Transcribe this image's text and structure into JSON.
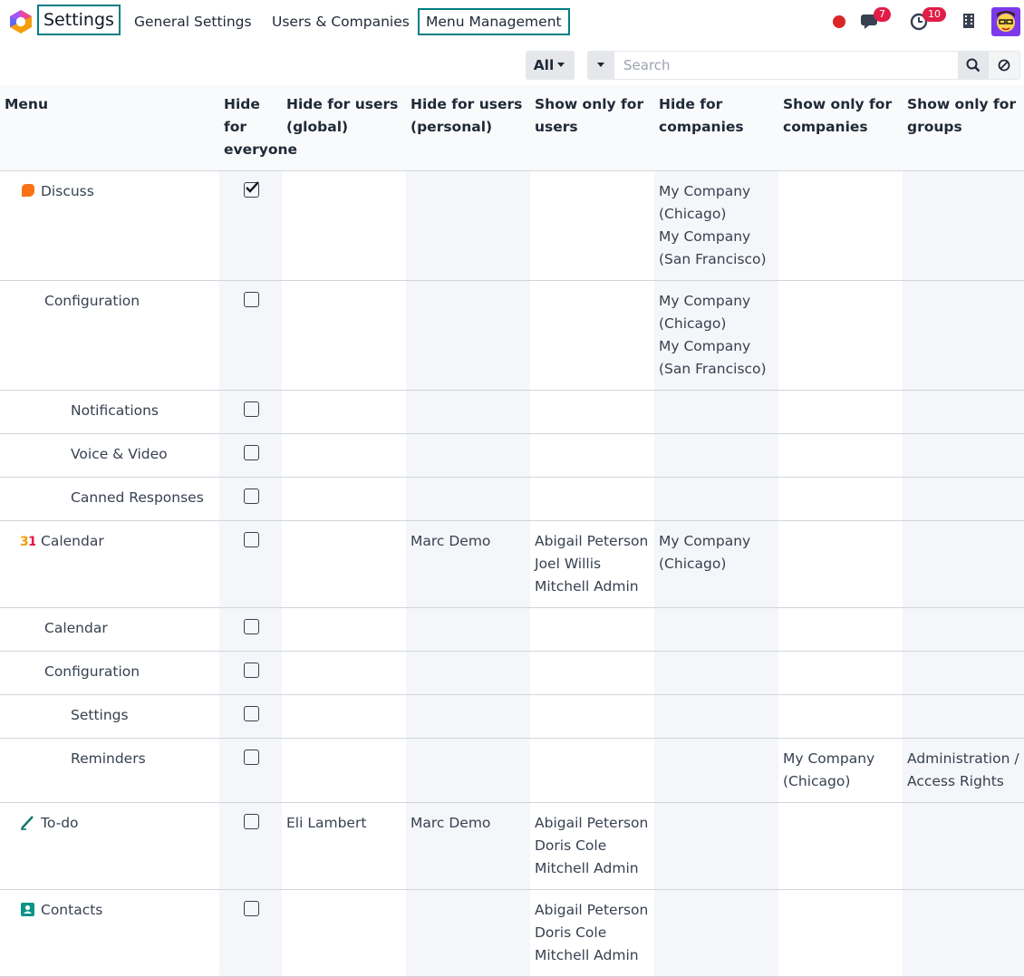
{
  "app": {
    "title": "Settings",
    "nav": [
      "General Settings",
      "Users & Companies",
      "Menu Management"
    ],
    "messages_count": "7",
    "activity_count": "10",
    "accent": "#017e84"
  },
  "controls": {
    "filter_label": "All",
    "search_placeholder": "Search"
  },
  "columns": [
    "Menu",
    "Hide for everyone",
    "Hide for users (global)",
    "Hide for users (personal)",
    "Show only for users",
    "Hide for companies",
    "Show only for companies",
    "Show only for groups"
  ],
  "rows": [
    {
      "name": "Discuss",
      "level": 0,
      "icon": "discuss-icon",
      "checked": true,
      "global": [],
      "personal": [],
      "show_users": [],
      "hide_companies": [
        "My Company",
        "(Chicago)",
        "My Company",
        "(San Francisco)"
      ],
      "show_companies": [],
      "groups": []
    },
    {
      "name": "Configuration",
      "level": 1,
      "checked": false,
      "global": [],
      "personal": [],
      "show_users": [],
      "hide_companies": [
        "My Company",
        "(Chicago)",
        "My Company",
        "(San Francisco)"
      ],
      "show_companies": [],
      "groups": []
    },
    {
      "name": "Notifications",
      "level": 2,
      "checked": false,
      "global": [],
      "personal": [],
      "show_users": [],
      "hide_companies": [],
      "show_companies": [],
      "groups": []
    },
    {
      "name": "Voice & Video",
      "level": 2,
      "checked": false,
      "global": [],
      "personal": [],
      "show_users": [],
      "hide_companies": [],
      "show_companies": [],
      "groups": []
    },
    {
      "name": "Canned Responses",
      "level": 2,
      "checked": false,
      "global": [],
      "personal": [],
      "show_users": [],
      "hide_companies": [],
      "show_companies": [],
      "groups": []
    },
    {
      "name": "Calendar",
      "level": 0,
      "icon": "calendar-icon",
      "checked": false,
      "global": [],
      "personal": [
        "Marc Demo"
      ],
      "show_users": [
        "Abigail Peterson",
        "Joel Willis",
        "Mitchell Admin"
      ],
      "hide_companies": [
        "My Company",
        "(Chicago)"
      ],
      "show_companies": [],
      "groups": []
    },
    {
      "name": "Calendar",
      "level": 1,
      "checked": false,
      "global": [],
      "personal": [],
      "show_users": [],
      "hide_companies": [],
      "show_companies": [],
      "groups": []
    },
    {
      "name": "Configuration",
      "level": 1,
      "checked": false,
      "global": [],
      "personal": [],
      "show_users": [],
      "hide_companies": [],
      "show_companies": [],
      "groups": []
    },
    {
      "name": "Settings",
      "level": 2,
      "checked": false,
      "global": [],
      "personal": [],
      "show_users": [],
      "hide_companies": [],
      "show_companies": [],
      "groups": []
    },
    {
      "name": "Reminders",
      "level": 2,
      "checked": false,
      "global": [],
      "personal": [],
      "show_users": [],
      "hide_companies": [],
      "show_companies": [
        "My Company",
        "(Chicago)"
      ],
      "groups": [
        "Administration /",
        "Access Rights"
      ]
    },
    {
      "name": "To-do",
      "level": 0,
      "icon": "todo-icon",
      "checked": false,
      "global": [
        "Eli Lambert"
      ],
      "personal": [
        "Marc Demo"
      ],
      "show_users": [
        "Abigail Peterson",
        "Doris Cole",
        "Mitchell Admin"
      ],
      "hide_companies": [],
      "show_companies": [],
      "groups": []
    },
    {
      "name": "Contacts",
      "level": 0,
      "icon": "contacts-icon",
      "checked": false,
      "global": [],
      "personal": [],
      "show_users": [
        "Abigail Peterson",
        "Doris Cole",
        "Mitchell Admin"
      ],
      "hide_companies": [],
      "show_companies": [],
      "groups": []
    }
  ]
}
